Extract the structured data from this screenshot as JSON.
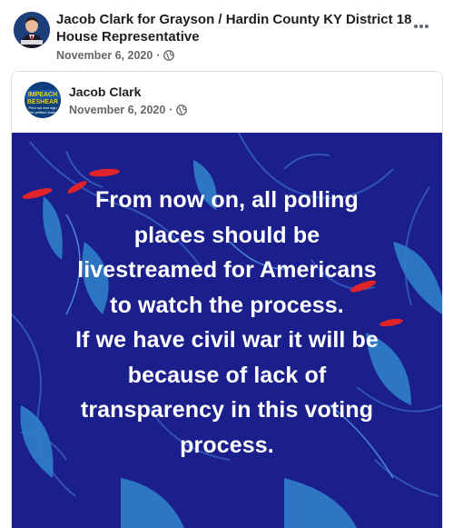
{
  "post": {
    "author": "Jacob Clark for Grayson / Hardin County KY District 18 House Representative",
    "date": "November 6, 2020",
    "audience_icon": "globe-icon",
    "more_icon": "more-options-icon"
  },
  "shared_post": {
    "author": "Jacob Clark",
    "date": "November 6, 2020",
    "audience_icon": "globe-icon",
    "avatar_text": [
      "IMPEACH",
      "BESHEAR",
      "Print out and sign",
      "the petition today"
    ],
    "image_lines": [
      "From now on, all polling",
      "places should be",
      "livestreamed for Americans",
      "to watch the process.",
      "If we have civil war it will be",
      "because of lack of",
      "transparency in this voting",
      "process."
    ]
  },
  "colors": {
    "image_bg": "#1a1f8c",
    "leaf": "#2f7fc9",
    "flower": "#e0242a",
    "meta_text": "#65676b"
  }
}
